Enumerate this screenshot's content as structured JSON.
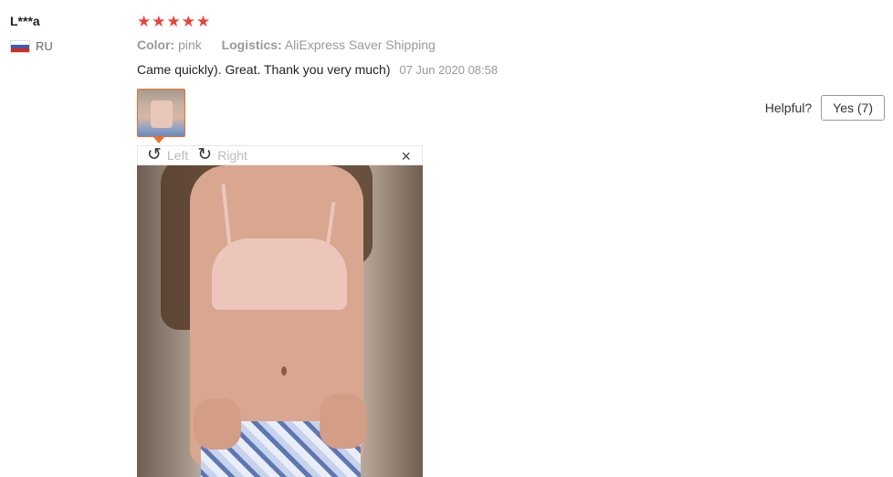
{
  "review": {
    "user_name": "L***a",
    "country_code": "RU",
    "flag_colors": [
      "#ffffff",
      "#3b5bb5",
      "#d52b1e"
    ],
    "rating": 5,
    "stars": [
      "★",
      "★",
      "★",
      "★",
      "★"
    ],
    "color_label": "Color:",
    "color_value": "pink",
    "logistics_label": "Logistics:",
    "logistics_value": "AliExpress Saver Shipping",
    "text": "Came quickly). Great. Thank you very much)",
    "date": "07 Jun 2020 08:58"
  },
  "helpful": {
    "label": "Helpful?",
    "yes_button": "Yes (7)"
  },
  "viewer": {
    "rotate_left_label": "Left",
    "rotate_right_label": "Right",
    "rotate_left_icon": "↺",
    "rotate_right_icon": "↻",
    "close_icon": "×"
  },
  "colors": {
    "star": "#e8433c",
    "thumb_border": "#e86f2c"
  }
}
